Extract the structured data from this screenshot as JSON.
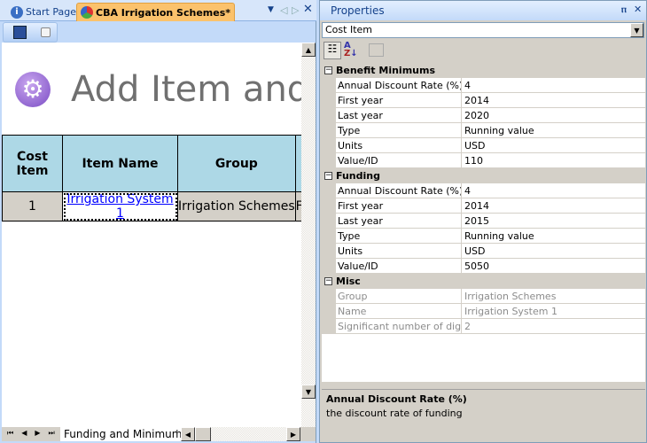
{
  "tabs": [
    {
      "label": "Start Page",
      "icon": "info-icon"
    },
    {
      "label": "CBA Irrigation Schemes*",
      "icon": "cba-icon"
    }
  ],
  "page": {
    "heading": "Add Item and"
  },
  "table": {
    "headers": [
      "Cost Item",
      "Item Name",
      "Group"
    ],
    "rows": [
      {
        "cost_item": "1",
        "item_name": "Irrigation System 1",
        "group": "Irrigation Schemes",
        "more": "F"
      }
    ]
  },
  "sheet_tab": "Funding and Minimums",
  "sheet_tab_next": "I",
  "properties": {
    "title": "Properties",
    "object": "Cost Item",
    "categories": [
      {
        "name": "Benefit Minimums",
        "rows": [
          [
            "Annual Discount Rate (%)",
            "4"
          ],
          [
            "First year",
            "2014"
          ],
          [
            "Last year",
            "2020"
          ],
          [
            "Type",
            "Running value"
          ],
          [
            "Units",
            "USD"
          ],
          [
            "Value/ID",
            "110"
          ]
        ]
      },
      {
        "name": "Funding",
        "rows": [
          [
            "Annual Discount Rate (%)",
            "4"
          ],
          [
            "First year",
            "2014"
          ],
          [
            "Last year",
            "2015"
          ],
          [
            "Type",
            "Running value"
          ],
          [
            "Units",
            "USD"
          ],
          [
            "Value/ID",
            "5050"
          ]
        ]
      },
      {
        "name": "Misc",
        "disabled": true,
        "rows": [
          [
            "Group",
            "Irrigation Schemes"
          ],
          [
            "Name",
            "Irrigation System 1"
          ],
          [
            "Significant number of digits",
            "2"
          ]
        ]
      }
    ],
    "description": {
      "title": "Annual Discount Rate (%)",
      "text": "the discount rate of funding"
    }
  }
}
